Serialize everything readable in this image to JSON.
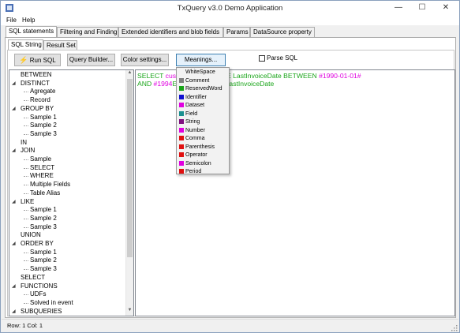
{
  "window": {
    "title": "TxQuery v3.0 Demo Application",
    "minimize_glyph": "—",
    "maximize_glyph": "☐",
    "close_glyph": "✕"
  },
  "menu": [
    "File",
    "Help"
  ],
  "main_tabs": [
    "SQL statements",
    "Filtering and Finding",
    "Extended identifiers and blob fields",
    "Params",
    "DataSource property"
  ],
  "active_main_tab": 0,
  "sub_tabs": [
    "SQL String",
    "Result Set"
  ],
  "active_sub_tab": 0,
  "toolbar": {
    "run_sql": "Run SQL",
    "query_builder": "Query Builder...",
    "color_settings": "Color settings...",
    "meanings": "Meanings...",
    "parse_sql": "Parse SQL",
    "parse_sql_checked": false
  },
  "tree": [
    {
      "label": "BETWEEN",
      "level": 0,
      "expander": ""
    },
    {
      "label": "DISTINCT",
      "level": 0,
      "expander": "◢"
    },
    {
      "label": "Agregate",
      "level": 1,
      "expander": ""
    },
    {
      "label": "Record",
      "level": 1,
      "expander": ""
    },
    {
      "label": "GROUP BY",
      "level": 0,
      "expander": "◢"
    },
    {
      "label": "Sample 1",
      "level": 1,
      "expander": ""
    },
    {
      "label": "Sample 2",
      "level": 1,
      "expander": ""
    },
    {
      "label": "Sample 3",
      "level": 1,
      "expander": ""
    },
    {
      "label": "IN",
      "level": 0,
      "expander": ""
    },
    {
      "label": "JOIN",
      "level": 0,
      "expander": "◢"
    },
    {
      "label": "Sample",
      "level": 1,
      "expander": ""
    },
    {
      "label": "SELECT",
      "level": 1,
      "expander": ""
    },
    {
      "label": "WHERE",
      "level": 1,
      "expander": ""
    },
    {
      "label": "Multiple Fields",
      "level": 1,
      "expander": ""
    },
    {
      "label": "Table Alias",
      "level": 1,
      "expander": ""
    },
    {
      "label": "LIKE",
      "level": 0,
      "expander": "◢"
    },
    {
      "label": "Sample 1",
      "level": 1,
      "expander": ""
    },
    {
      "label": "Sample 2",
      "level": 1,
      "expander": ""
    },
    {
      "label": "Sample 3",
      "level": 1,
      "expander": ""
    },
    {
      "label": "UNION",
      "level": 0,
      "expander": ""
    },
    {
      "label": "ORDER BY",
      "level": 0,
      "expander": "◢"
    },
    {
      "label": "Sample 1",
      "level": 1,
      "expander": ""
    },
    {
      "label": "Sample 2",
      "level": 1,
      "expander": ""
    },
    {
      "label": "Sample 3",
      "level": 1,
      "expander": ""
    },
    {
      "label": "SELECT",
      "level": 0,
      "expander": ""
    },
    {
      "label": "FUNCTIONS",
      "level": 0,
      "expander": "◢"
    },
    {
      "label": "UDFs",
      "level": 1,
      "expander": ""
    },
    {
      "label": "Solved in event",
      "level": 1,
      "expander": ""
    },
    {
      "label": "SUBQUERIES",
      "level": 0,
      "expander": "◢"
    }
  ],
  "sql_lines": [
    [
      {
        "t": "SELECT ",
        "c": "#1aa51a"
      },
      {
        "t": "cus",
        "c": "#e000e0"
      },
      {
        "t": "customer ",
        "c": "#e000e0"
      },
      {
        "t": "WHERE ",
        "c": "#1aa51a"
      },
      {
        "t": "LastInvoiceDate ",
        "c": "#1aa51a"
      },
      {
        "t": "BETWEEN ",
        "c": "#1aa51a"
      },
      {
        "t": "#1990-01-01#",
        "c": "#e000e0"
      }
    ],
    [
      {
        "t": "AND ",
        "c": "#1aa51a"
      },
      {
        "t": "#1994",
        "c": "#e000e0"
      },
      {
        "t": "ER BY ",
        "c": "#1aa51a"
      },
      {
        "t": "Customer",
        "c": "#e000e0"
      },
      {
        "t": ".",
        "c": "#1aa51a"
      },
      {
        "t": "LastInvoiceDate",
        "c": "#1aa51a"
      }
    ]
  ],
  "meanings_popup": [
    {
      "label": "WhiteSpace",
      "color": "#f2f2f2"
    },
    {
      "label": "Comment",
      "color": "#808080"
    },
    {
      "label": "ReservedWord",
      "color": "#1aa51a"
    },
    {
      "label": "Identifier",
      "color": "#1010d0"
    },
    {
      "label": "Dataset",
      "color": "#e000e0"
    },
    {
      "label": "Field",
      "color": "#1a9090"
    },
    {
      "label": "String",
      "color": "#801080"
    },
    {
      "label": "Number",
      "color": "#e000e0"
    },
    {
      "label": "Comma",
      "color": "#e01010"
    },
    {
      "label": "Parenthesis",
      "color": "#e01010"
    },
    {
      "label": "Operator",
      "color": "#e01010"
    },
    {
      "label": "Semicolon",
      "color": "#e000e0"
    },
    {
      "label": "Period",
      "color": "#e01010"
    }
  ],
  "status": {
    "text": "Row: 1 Col: 1"
  }
}
